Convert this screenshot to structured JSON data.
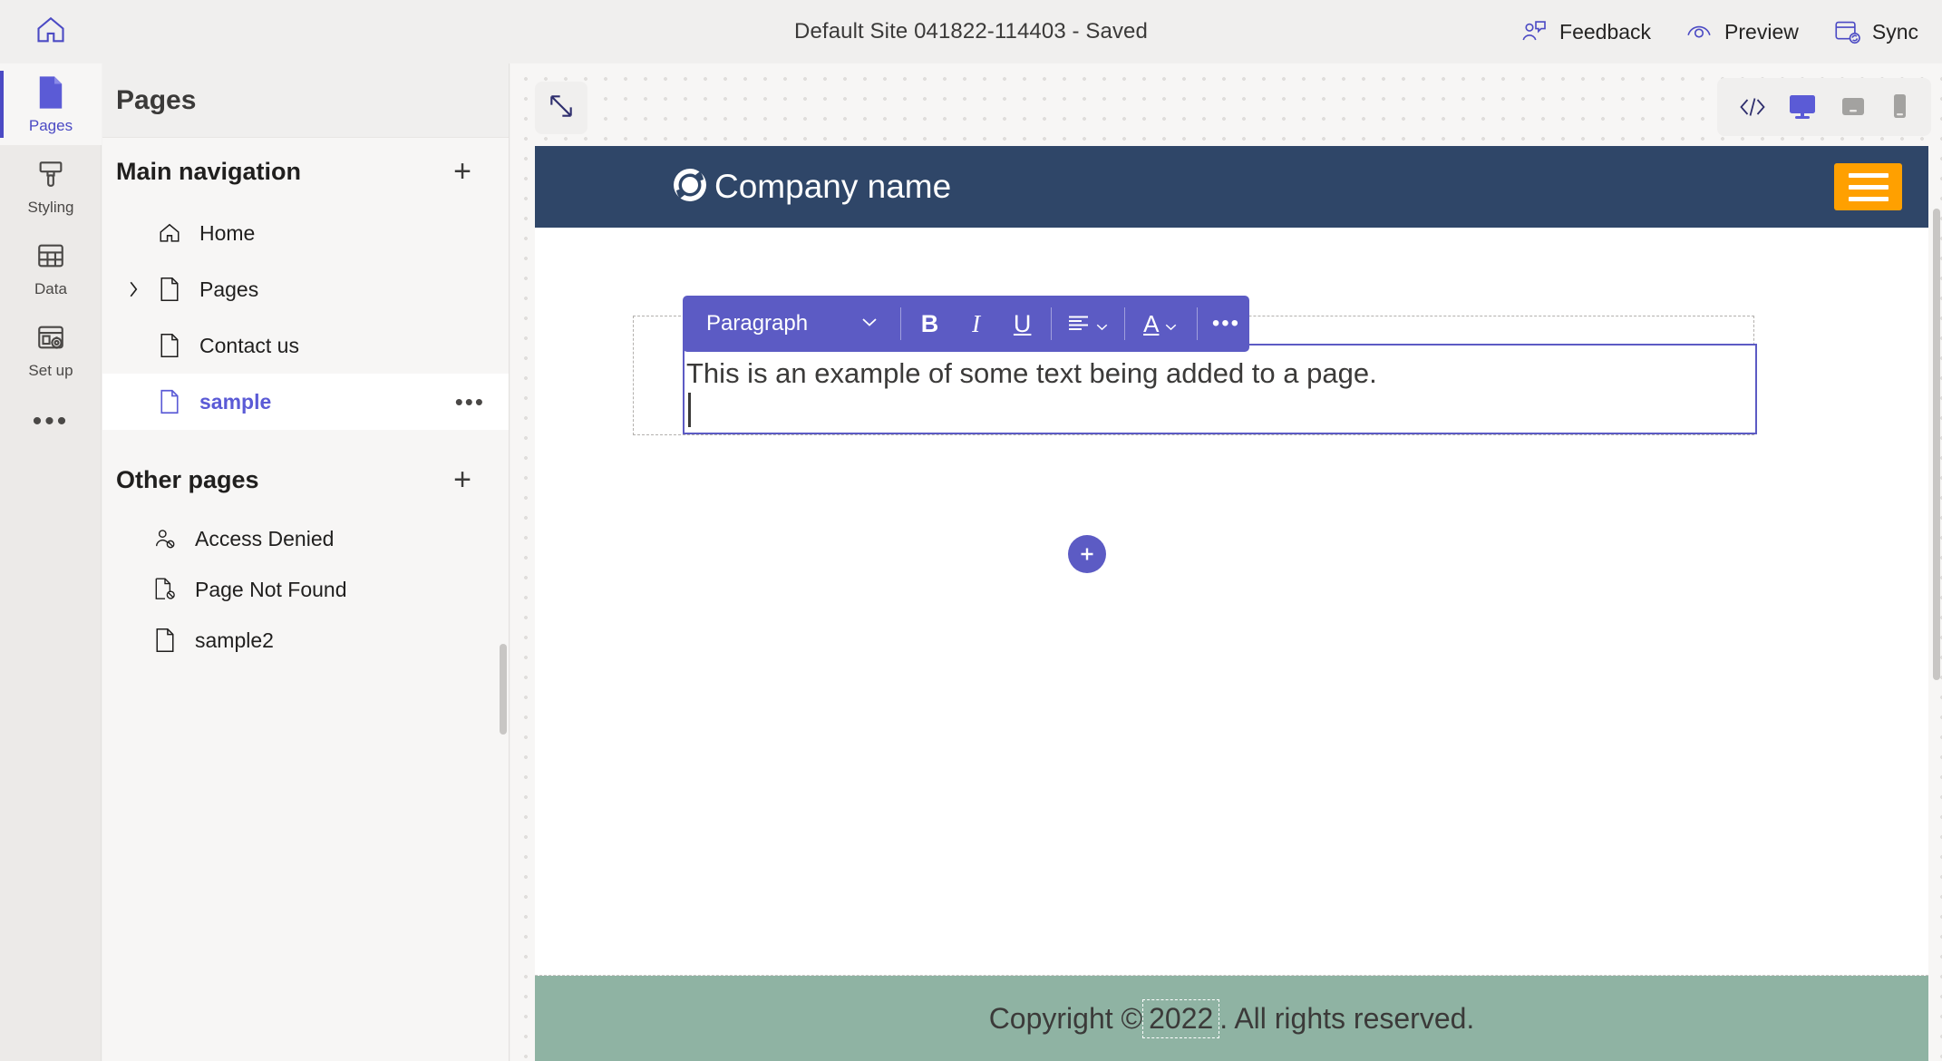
{
  "topbar": {
    "home_icon": "home-icon",
    "title": "Default Site 041822-114403 - Saved",
    "actions": [
      {
        "label": "Feedback",
        "icon": "feedback-icon"
      },
      {
        "label": "Preview",
        "icon": "eye-icon"
      },
      {
        "label": "Sync",
        "icon": "sync-icon"
      }
    ]
  },
  "rail": {
    "items": [
      {
        "label": "Pages",
        "icon": "page-icon",
        "active": true
      },
      {
        "label": "Styling",
        "icon": "brush-icon",
        "active": false
      },
      {
        "label": "Data",
        "icon": "table-icon",
        "active": false
      },
      {
        "label": "Set up",
        "icon": "setup-gear-icon",
        "active": false
      }
    ],
    "more_label": "•••"
  },
  "panel": {
    "header": "Pages",
    "main_navigation": {
      "title": "Main navigation",
      "add_label": "+",
      "items": [
        {
          "label": "Home",
          "icon": "home-icon",
          "expandable": false,
          "selected": false
        },
        {
          "label": "Pages",
          "icon": "page-icon",
          "expandable": true,
          "selected": false
        },
        {
          "label": "Contact us",
          "icon": "page-icon",
          "expandable": false,
          "selected": false
        },
        {
          "label": "sample",
          "icon": "page-icon",
          "expandable": false,
          "selected": true,
          "overflow": "•••"
        }
      ]
    },
    "other_pages": {
      "title": "Other pages",
      "add_label": "+",
      "items": [
        {
          "label": "Access Denied",
          "icon": "person-blocked-icon"
        },
        {
          "label": "Page Not Found",
          "icon": "page-blocked-icon"
        },
        {
          "label": "sample2",
          "icon": "page-icon"
        }
      ]
    }
  },
  "canvas": {
    "expand_icon": "expand-diagonal-icon",
    "viewport_buttons": [
      {
        "name": "code-view",
        "label": "</>",
        "active": false
      },
      {
        "name": "desktop-view",
        "label": "",
        "active": true
      },
      {
        "name": "tablet-view",
        "label": "",
        "active": false
      },
      {
        "name": "mobile-view",
        "label": "",
        "active": false
      }
    ]
  },
  "site": {
    "brand": "Company name",
    "logo_icon": "circle-logo-icon",
    "menu_icon": "hamburger-icon",
    "header_bg": "#2f4668",
    "menu_bg": "#ffa000",
    "footer_bg": "#8fb3a3",
    "footer": {
      "prefix": "Copyright © ",
      "year": "2022",
      "suffix": ". All rights reserved."
    }
  },
  "editor": {
    "toolbar": {
      "paragraph_label": "Paragraph",
      "chevron": "⌄",
      "bold": "B",
      "italic": "I",
      "underline": "U",
      "align": "align-icon",
      "text_color": "A",
      "more": "•••"
    },
    "content": "This is an example of some text being added to a page.",
    "add_block_label": "+",
    "accent_color": "#5c5bc4"
  }
}
